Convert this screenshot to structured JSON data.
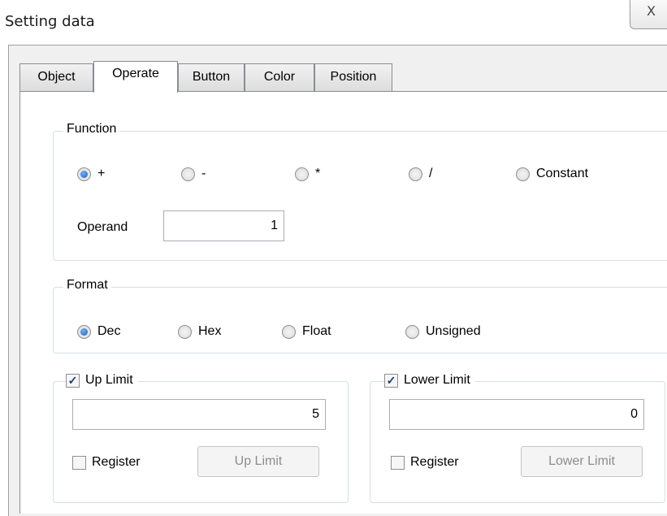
{
  "window": {
    "title": "Setting data",
    "close_glyph": "X"
  },
  "tabs": [
    {
      "label": "Object"
    },
    {
      "label": "Operate"
    },
    {
      "label": "Button"
    },
    {
      "label": "Color"
    },
    {
      "label": "Position"
    }
  ],
  "active_tab": "Operate",
  "function": {
    "legend": "Function",
    "options": [
      "+",
      "-",
      "*",
      "/",
      "Constant"
    ],
    "selected": "+",
    "operand_label": "Operand",
    "operand_value": "1"
  },
  "format": {
    "legend": "Format",
    "options": [
      "Dec",
      "Hex",
      "Float",
      "Unsigned"
    ],
    "selected": "Dec"
  },
  "up_limit": {
    "checkbox_label": "Up Limit",
    "checked": true,
    "value": "5",
    "register_label": "Register",
    "register_checked": false,
    "button_label": "Up Limit"
  },
  "lower_limit": {
    "checkbox_label": "Lower Limit",
    "checked": true,
    "value": "0",
    "register_label": "Register",
    "register_checked": false,
    "button_label": "Lower Limit"
  },
  "check_mark": "✓"
}
